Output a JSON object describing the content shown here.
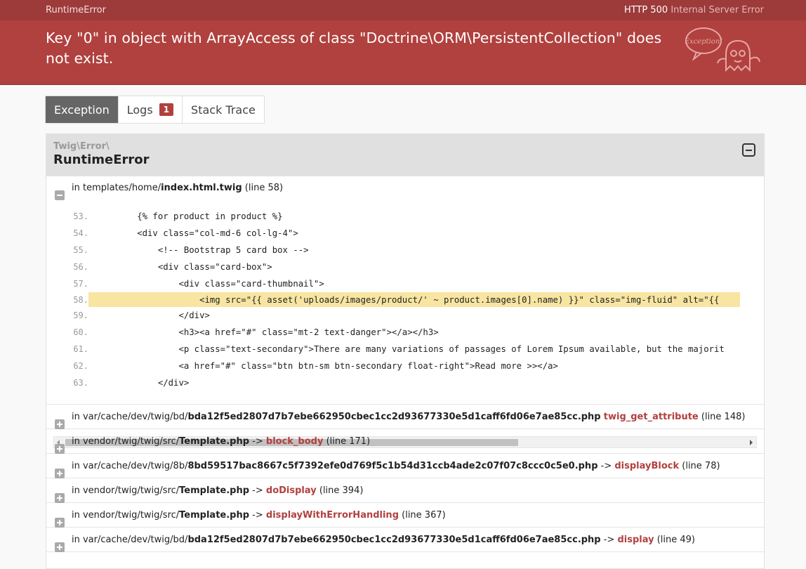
{
  "top_bar": {
    "exception_type": "RuntimeError",
    "http_code": "HTTP 500",
    "http_text": "Internal Server Error"
  },
  "header": {
    "message": "Key \"0\" in object with ArrayAccess of class \"Doctrine\\ORM\\PersistentCollection\" does not exist.",
    "logo_text": "Exception!"
  },
  "tabs": [
    {
      "label": "Exception",
      "active": true
    },
    {
      "label": "Logs",
      "badge": "1"
    },
    {
      "label": "Stack Trace"
    }
  ],
  "exception": {
    "namespace": "Twig\\Error\\",
    "class": "RuntimeError",
    "location": {
      "prefix": "in",
      "dir": "templates/home/",
      "file": "index.html.twig",
      "line": "(line 58)"
    },
    "code_lines": [
      {
        "n": "53.",
        "text": "        {% for product in product %}"
      },
      {
        "n": "54.",
        "text": "        <div class=\"col-md-6 col-lg-4\">"
      },
      {
        "n": "55.",
        "text": "            <!-- Bootstrap 5 card box -->"
      },
      {
        "n": "56.",
        "text": "            <div class=\"card-box\">"
      },
      {
        "n": "57.",
        "text": "                <div class=\"card-thumbnail\">"
      },
      {
        "n": "58.",
        "text": "                    <img src=\"{{ asset('uploads/images/product/' ~ product.images[0].name) }}\" class=\"img-fluid\" alt=\"{{",
        "highlight": true
      },
      {
        "n": "59.",
        "text": "                </div>"
      },
      {
        "n": "60.",
        "text": "                <h3><a href=\"#\" class=\"mt-2 text-danger\"></a></h3>"
      },
      {
        "n": "61.",
        "text": "                <p class=\"text-secondary\">There are many variations of passages of Lorem Ipsum available, but the majorit"
      },
      {
        "n": "62.",
        "text": "                <a href=\"#\" class=\"btn btn-sm btn-secondary float-right\">Read more >></a>"
      },
      {
        "n": "63.",
        "text": "            </div>"
      }
    ]
  },
  "trace": [
    {
      "prefix": "in",
      "dir": "var/cache/dev/twig/bd/",
      "file": "bda12f5ed2807d7b7ebe662950cbec1cc2d93677330e5d1caff6fd06e7ae85cc.php",
      "arrow": "",
      "fn": "twig_get_attribute",
      "line": "(line 148)"
    },
    {
      "prefix": "in",
      "dir": "vendor/twig/twig/src/",
      "file": "Template.php",
      "arrow": "->",
      "fn": "block_body",
      "line": "(line 171)"
    },
    {
      "prefix": "in",
      "dir": "var/cache/dev/twig/8b/",
      "file": "8bd59517bac8667c5f7392efe0d769f5c1b54d31ccb4ade2c07f07c8ccc0c5e0.php",
      "arrow": "->",
      "fn": "displayBlock",
      "line": "(line 78)"
    },
    {
      "prefix": "in",
      "dir": "vendor/twig/twig/src/",
      "file": "Template.php",
      "arrow": "->",
      "fn": "doDisplay",
      "line": "(line 394)"
    },
    {
      "prefix": "in",
      "dir": "vendor/twig/twig/src/",
      "file": "Template.php",
      "arrow": "->",
      "fn": "displayWithErrorHandling",
      "line": "(line 367)"
    },
    {
      "prefix": "in",
      "dir": "var/cache/dev/twig/bd/",
      "file": "bda12f5ed2807d7b7ebe662950cbec1cc2d93677330e5d1caff6fd06e7ae85cc.php",
      "arrow": "->",
      "fn": "display",
      "line": "(line 49)"
    }
  ]
}
